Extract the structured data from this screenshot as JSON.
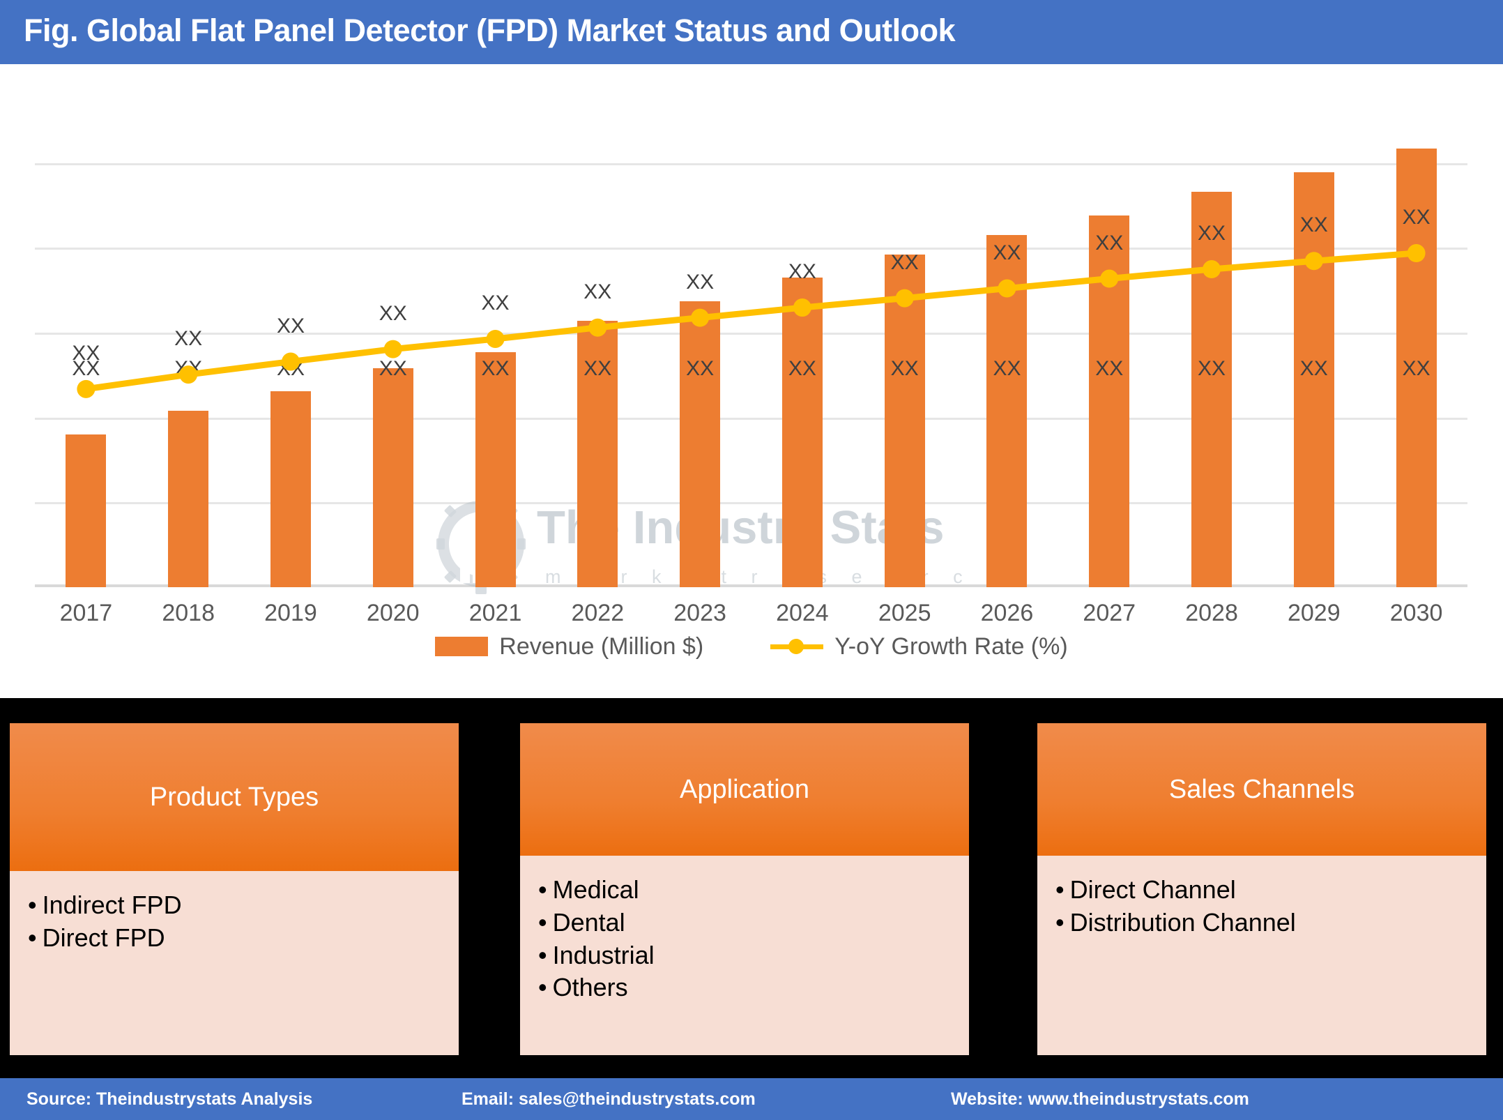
{
  "header": {
    "title": "Fig. Global Flat Panel Detector (FPD) Market Status and Outlook",
    "background_color": "#4472C4",
    "text_color": "#FFFFFF"
  },
  "watermark": {
    "title": "The Industry Stats",
    "subtitle": "m a r k e t   r e s e a r c h",
    "logo_icon": "gear-building-icon",
    "color": "#A9B4BD"
  },
  "chart_data": {
    "type": "bar",
    "title": "Global Flat Panel Detector (FPD) Market Status and Outlook",
    "xlabel": "",
    "ylabel": "",
    "grid": true,
    "gridlines": 5,
    "legend_position": "bottom",
    "categories": [
      "2017",
      "2018",
      "2019",
      "2020",
      "2021",
      "2022",
      "2023",
      "2024",
      "2025",
      "2026",
      "2027",
      "2028",
      "2029",
      "2030"
    ],
    "series": [
      {
        "name": "Revenue (Million $)",
        "type": "bar",
        "color": "#ED7D31",
        "axis": "left",
        "value_labels": [
          "XX",
          "XX",
          "XX",
          "XX",
          "XX",
          "XX",
          "XX",
          "XX",
          "XX",
          "XX",
          "XX",
          "XX",
          "XX",
          "XX"
        ],
        "values": [
          39,
          45,
          50,
          56,
          60,
          68,
          73,
          79,
          85,
          90,
          95,
          101,
          106,
          112
        ],
        "ylim": [
          0,
          130
        ]
      },
      {
        "name": "Y-oY Growth Rate (%)",
        "type": "line",
        "color": "#FFC000",
        "axis": "right",
        "marker": "circle",
        "value_labels": [
          "XX",
          "XX",
          "XX",
          "XX",
          "XX",
          "XX",
          "XX",
          "XX",
          "XX",
          "XX",
          "XX",
          "XX",
          "XX",
          "XX"
        ],
        "values": [
          50.6,
          54.3,
          57.6,
          60.8,
          63.4,
          66.3,
          68.8,
          71.4,
          73.8,
          76.3,
          78.8,
          81.2,
          83.3,
          85.3
        ],
        "ylim": [
          0,
          130
        ]
      }
    ]
  },
  "legend": [
    {
      "label": "Revenue (Million $)",
      "marker": "bar-swatch",
      "color": "#ED7D31"
    },
    {
      "label": "Y-oY Growth Rate (%)",
      "marker": "line-marker",
      "color": "#FFC000"
    }
  ],
  "segments": {
    "background_color": "#000000",
    "header_color": "#EF7E2F",
    "body_color": "#F7DED4",
    "cards": [
      {
        "title": "Product Types",
        "items": [
          "Indirect FPD",
          "Direct FPD"
        ]
      },
      {
        "title": "Application",
        "items": [
          "Medical",
          "Dental",
          "Industrial",
          "Others"
        ]
      },
      {
        "title": "Sales Channels",
        "items": [
          "Direct Channel",
          "Distribution Channel"
        ]
      }
    ]
  },
  "footer": {
    "background_color": "#4472C4",
    "items": [
      "Source: Theindustrystats Analysis",
      "Email: sales@theindustrystats.com",
      "Website: www.theindustrystats.com"
    ]
  }
}
